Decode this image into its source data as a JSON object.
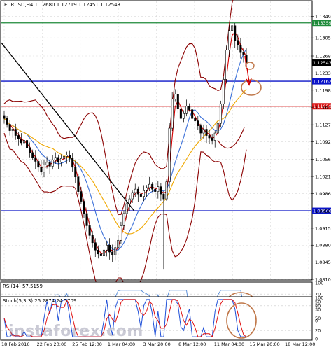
{
  "header": {
    "symbol_line": "EURUSD,H4  1.12680 1.12719 1.12451 1.12543"
  },
  "rsi_panel": {
    "label": "RSI(14) 57.5159",
    "ticks": [
      "100",
      "70",
      "50",
      "30",
      "0"
    ]
  },
  "stoch_panel": {
    "label": "Stoch(5,3,3) 25.2874 24.5709",
    "ticks": [
      "100",
      "80",
      "50",
      "20",
      "0"
    ]
  },
  "price_axis": {
    "ticks": [
      "1.13490",
      "1.13050",
      "1.12680",
      "1.12330",
      "1.11980",
      "1.11630",
      "1.11270",
      "1.10920",
      "1.10560",
      "1.10210",
      "1.09860",
      "1.09500",
      "1.09150",
      "1.08800",
      "1.08450",
      "1.08100"
    ],
    "current_price": "1.12543"
  },
  "levels": [
    {
      "label": "1.13359",
      "color": "#1e8a3a"
    },
    {
      "label": "1.12162",
      "color": "#0a14c8"
    },
    {
      "label": "1.11650",
      "color": "#d81818"
    },
    {
      "label": "1.09506",
      "color": "#0a14c8"
    }
  ],
  "time_axis": {
    "ticks": [
      "18 Feb 2016",
      "22 Feb 20:00",
      "25 Feb 12:00",
      "1 Mar 04:00",
      "3 Mar 20:00",
      "8 Mar 12:00",
      "11 Mar 04:00",
      "15 Mar 20:00",
      "18 Mar 12:00"
    ]
  },
  "watermark": "instaforex.com",
  "colors": {
    "bull_candle": "#ffffff",
    "bear_candle": "#000000",
    "bollinger": "#8b0000",
    "ma_fast": "#d40000",
    "ma_mid": "#3a6fd8",
    "ma_slow": "#f0a800",
    "trendline": "#000000",
    "rsi_line": "#5b8fd8",
    "stoch_main": "#1e4fd8",
    "stoch_signal": "#e01010",
    "annotation": "#c0784a"
  },
  "chart_data": {
    "type": "candlestick",
    "symbol": "EURUSD",
    "timeframe": "H4",
    "ylim": [
      1.081,
      1.138
    ],
    "closes": [
      1.114,
      1.1128,
      1.1115,
      1.1118,
      1.1105,
      1.1098,
      1.109,
      1.1095,
      1.108,
      1.107,
      1.106,
      1.1052,
      1.104,
      1.103,
      1.1045,
      1.105,
      1.1042,
      1.1055,
      1.106,
      1.105,
      1.1058,
      1.1062,
      1.1065,
      1.1058,
      1.104,
      1.102,
      1.099,
      1.097,
      1.0945,
      1.092,
      1.09,
      1.0885,
      1.087,
      1.0862,
      1.0858,
      1.087,
      1.088,
      1.0866,
      1.086,
      1.0875,
      1.089,
      1.092,
      1.0945,
      1.0965,
      1.0975,
      1.0988,
      1.0995,
      1.0985,
      1.098,
      1.0992,
      1.0998,
      1.1005,
      1.0995,
      1.099,
      1.1,
      1.0985,
      1.0975,
      1.101,
      1.112,
      1.118,
      1.119,
      1.116,
      1.114,
      1.115,
      1.1165,
      1.1158,
      1.114,
      1.1135,
      1.1125,
      1.111,
      1.1118,
      1.1105,
      1.11,
      1.1095,
      1.111,
      1.113,
      1.117,
      1.122,
      1.128,
      1.132,
      1.133,
      1.13,
      1.129,
      1.1275,
      1.127,
      1.1254
    ]
  }
}
